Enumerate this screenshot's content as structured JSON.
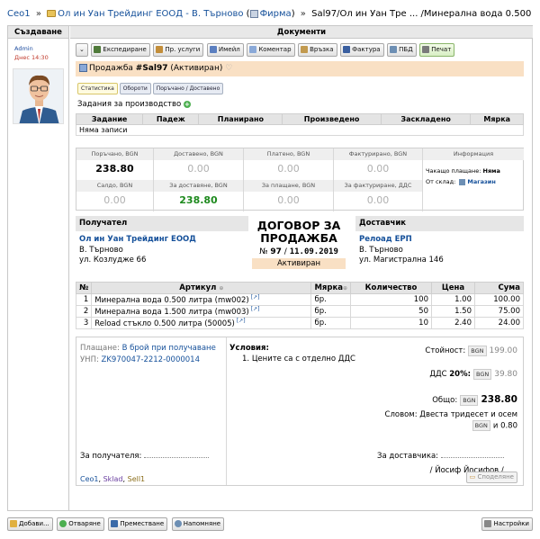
{
  "breadcrumb": {
    "root": "Ceo1",
    "sep": "»",
    "company": "Ол ин Уан Трейдинг ЕООД - В. Търново",
    "firm_label": "Фирма",
    "current": "Sal97/Ол ин Уан Тре ... /Минерална вода 0.500"
  },
  "columns": {
    "left": "Създаване",
    "main": "Документи"
  },
  "user": {
    "name": "Admin",
    "time": "Днес 14:30"
  },
  "toolbar": {
    "expedite": "Експедиране",
    "services": "Пр. услуги",
    "email": "Имейл",
    "comment": "Коментар",
    "link": "Връзка",
    "invoice": "Фактура",
    "pbd": "ПБД",
    "print": "Печат"
  },
  "doc": {
    "prefix": "Продажба",
    "number": "#Sal97",
    "status": "(Активиран)"
  },
  "tabs": [
    "Статистика",
    "Обороти",
    "Поръчано / Доставено"
  ],
  "production": {
    "label": "Задания за производство",
    "headers": [
      "Задание",
      "Падеж",
      "Планирано",
      "Произведено",
      "Заскладено",
      "Мярка"
    ],
    "empty": "Няма записи"
  },
  "summary": {
    "ordered_lbl": "Поръчано, BGN",
    "ordered": "238.80",
    "delivered_lbl": "Доставено, BGN",
    "delivered": "0.00",
    "paid_lbl": "Платено, BGN",
    "paid": "0.00",
    "invoiced_lbl": "Фактурирано, BGN",
    "invoiced": "0.00",
    "balance_lbl": "Салдо, BGN",
    "balance": "0.00",
    "to_deliver_lbl": "За доставяне, BGN",
    "to_deliver": "238.80",
    "to_pay_lbl": "За плащане, BGN",
    "to_pay": "0.00",
    "to_invoice_lbl": "За фактуриране, ДДС",
    "to_invoice": "0.00",
    "info_lbl": "Информация",
    "pending_pay_lbl": "Чакащо плащане:",
    "pending_pay": "Няма",
    "from_store_lbl": "От склад:",
    "from_store": "Магазин"
  },
  "recipient": {
    "head": "Получател",
    "name": "Ол ин Уан Трейдинг ЕООД",
    "city": "В. Търново",
    "address": "ул. Козлудже 66"
  },
  "contract": {
    "title": "ДОГОВОР ЗА ПРОДАЖБА",
    "no_label": "№",
    "number": "97",
    "date_sep": "/",
    "date": "11.09.2019",
    "status": "Активиран"
  },
  "supplier": {
    "head": "Доставчик",
    "name": "Релоад ЕРП",
    "city": "В. Търново",
    "address": "ул. Магистрална 146"
  },
  "items": {
    "headers": [
      "№",
      "Артикул",
      "Мярка",
      "Количество",
      "Цена",
      "Сума"
    ],
    "rows": [
      {
        "n": "1",
        "name": "Минерална вода 0.500 литра (mw002)",
        "unit": "бр.",
        "qty": "100",
        "price": "1.00",
        "sum": "100.00"
      },
      {
        "n": "2",
        "name": "Минерална вода 1.500 литра (mw003)",
        "unit": "бр.",
        "qty": "50",
        "price": "1.50",
        "sum": "75.00"
      },
      {
        "n": "3",
        "name": "Reload стъкло 0.500 литра (50005)",
        "unit": "бр.",
        "qty": "10",
        "price": "2.40",
        "sum": "24.00"
      }
    ]
  },
  "payment": {
    "label": "Плащане:",
    "value": "В брой при получаване",
    "unp_label": "УНП:",
    "unp": "ZK970047-2212-0000014"
  },
  "conditions": {
    "title": "Условия:",
    "items": [
      "Цените са с отделно ДДС"
    ]
  },
  "totals": {
    "cost_lbl": "Стойност:",
    "currency": "BGN",
    "cost": "199.00",
    "vat_lbl": "ДДС",
    "vat_pct": "20%:",
    "vat": "39.80",
    "total_lbl": "Общо:",
    "total": "238.80",
    "words_lbl": "Словом:",
    "words": "Двеста тридесет и осем",
    "words_end": "и 0.80"
  },
  "signatures": {
    "recipient": "За получателя:",
    "supplier": "За доставчика:",
    "supplier_name": "/ Йосиф Йосифов /"
  },
  "tagline": {
    "a": "Ceo1",
    "b": "Sklad",
    "c": "Sell1",
    "sep": ","
  },
  "share_btn": "Споделяне",
  "footer": {
    "add": "Добави...",
    "open": "Отваряне",
    "move": "Преместване",
    "reminder": "Напомняне",
    "settings": "Настройки"
  }
}
